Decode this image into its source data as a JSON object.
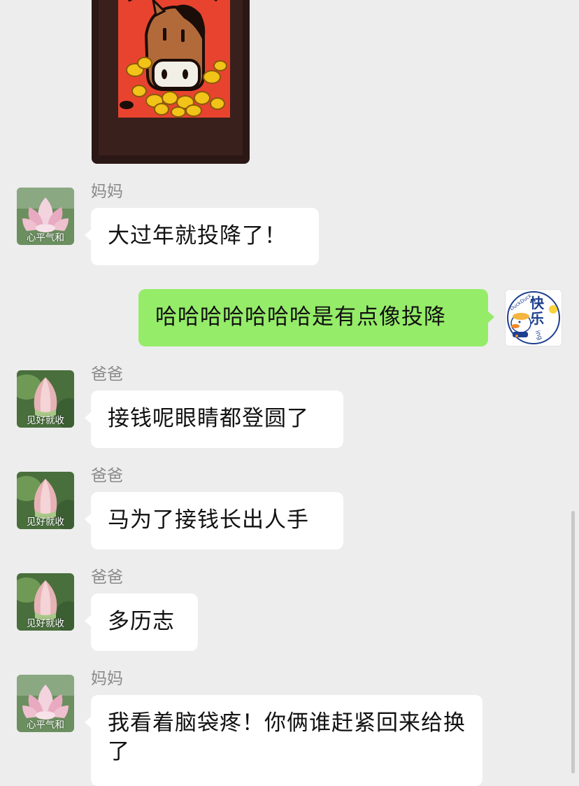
{
  "conversation": {
    "messages": [
      {
        "sender": "妈妈",
        "avatar_caption": "心平气和",
        "text": "大过年就投降了！"
      },
      {
        "sender": "",
        "avatar_caption": "",
        "text": "哈哈哈哈哈哈哈是有点像投降"
      },
      {
        "sender": "爸爸",
        "avatar_caption": "见好就收",
        "text": "接钱呢眼睛都登圆了"
      },
      {
        "sender": "爸爸",
        "avatar_caption": "见好就收",
        "text": "马为了接钱长出人手"
      },
      {
        "sender": "爸爸",
        "avatar_caption": "见好就收",
        "text": "多历志"
      },
      {
        "sender": "妈妈",
        "avatar_caption": "心平气和",
        "text": "我看着脑袋疼！你俩谁赶紧回来给换了"
      }
    ],
    "self_avatar": {
      "text_main": "快乐",
      "text_small_top": "DuckDuck",
      "text_small_bottom": "ing"
    }
  },
  "colors": {
    "background": "#ededed",
    "incoming_bubble": "#ffffff",
    "outgoing_bubble": "#95ec69",
    "sender_name": "#8a8a8a"
  },
  "icons": {
    "mom_avatar": "pink-lotus-flower",
    "dad_avatar": "lotus-bud",
    "self_avatar": "duck-cartoon"
  }
}
